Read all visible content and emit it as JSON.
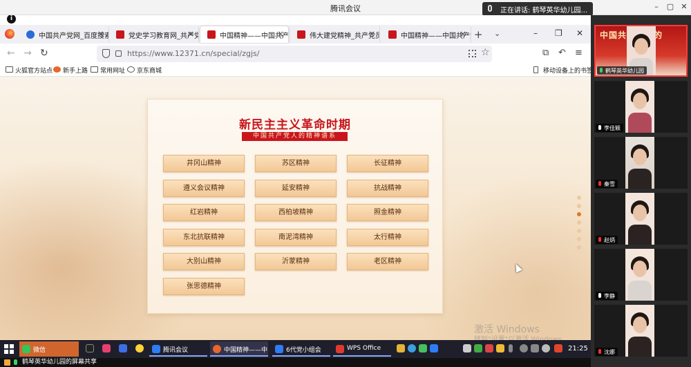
{
  "meeting": {
    "title": "腾讯会议",
    "speaking": "正在讲话: 鹤琴英华幼儿园..."
  },
  "browser": {
    "tabs": [
      {
        "label": "中国共产党网_百度搜索"
      },
      {
        "label": "党史学习教育网_共产党员"
      },
      {
        "label": "中国精神——中国共产党..."
      },
      {
        "label": "伟大建党精神_共产党员网"
      },
      {
        "label": "中国精神——中国共产党..."
      }
    ],
    "active_tab": 2,
    "url": "https://www.12371.cn/special/zgjs/",
    "bookmarks": [
      "火狐官方站点",
      "新手上路",
      "常用网址",
      "京东商城"
    ],
    "mobile_bookmarks": "移动设备上的书签"
  },
  "page": {
    "title": "新民主主义革命时期",
    "subtitle": "中国共产党人的精神谱系",
    "spirits": [
      "井冈山精神",
      "苏区精神",
      "长征精神",
      "遵义会议精神",
      "延安精神",
      "抗战精神",
      "红岩精神",
      "西柏坡精神",
      "照金精神",
      "东北抗联精神",
      "南泥湾精神",
      "太行精神",
      "大别山精神",
      "沂蒙精神",
      "老区精神",
      "张思德精神"
    ],
    "pager_dots": 7,
    "pager_active": 2,
    "activation_line1": "激活 Windows",
    "activation_line2": "转到\"设置\"以激活 Windows。"
  },
  "taskbar": {
    "items": [
      "微信",
      "腾讯会议",
      "中国精神——中...",
      "6代党小组会",
      "WPS Office"
    ],
    "time": "21:25"
  },
  "share_bar": "鹤琴英华幼儿园的屏幕共享",
  "participants": [
    {
      "name": "鹤琴英华幼儿园",
      "banner": "中国共产党人的"
    },
    {
      "name": "李佳颖"
    },
    {
      "name": "秦雪"
    },
    {
      "name": "赵炳"
    },
    {
      "name": "李静"
    },
    {
      "name": "沈娜"
    }
  ],
  "colors": {
    "accent_red": "#c8161d",
    "button_fill": "#f2c896",
    "active_dot": "#e0762c"
  }
}
